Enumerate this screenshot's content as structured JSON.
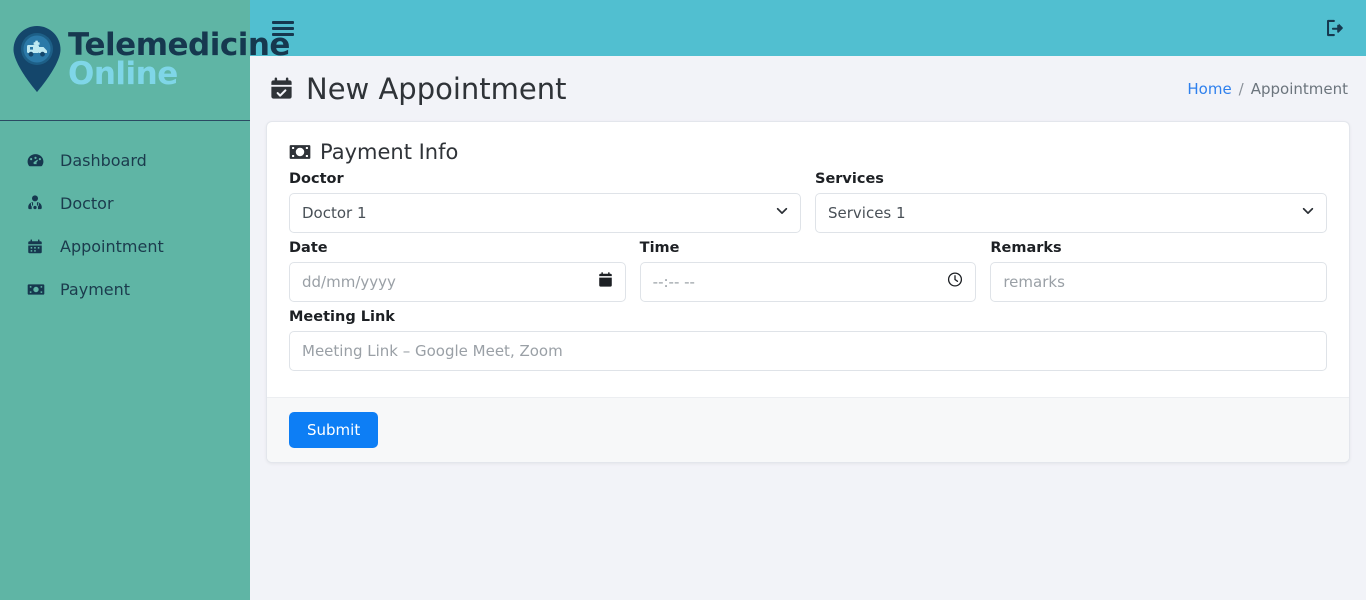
{
  "brand": {
    "line1": "Telemedicine",
    "line2": "Online",
    "logo_icon": "map-pin-ambulance-icon"
  },
  "sidebar": {
    "items": [
      {
        "label": "Dashboard",
        "icon": "tachometer-icon"
      },
      {
        "label": "Doctor",
        "icon": "user-doctor-icon"
      },
      {
        "label": "Appointment",
        "icon": "calendar-days-icon"
      },
      {
        "label": "Payment",
        "icon": "money-bill-icon"
      }
    ]
  },
  "topbar": {
    "menu_icon": "hamburger-icon",
    "logout_icon": "sign-out-icon"
  },
  "page": {
    "title": "New Appointment",
    "title_icon": "calendar-check-icon",
    "breadcrumb": {
      "home": "Home",
      "separator": "/",
      "current": "Appointment"
    }
  },
  "form": {
    "section_title": "Payment Info",
    "section_icon": "money-bill-icon",
    "doctor": {
      "label": "Doctor",
      "value": "Doctor 1",
      "options": [
        "Doctor 1"
      ]
    },
    "services": {
      "label": "Services",
      "value": "Services 1",
      "options": [
        "Services 1"
      ]
    },
    "date": {
      "label": "Date",
      "value": "",
      "placeholder": "dd/mm/yyyy",
      "icon": "calendar-picker-icon"
    },
    "time": {
      "label": "Time",
      "value": "",
      "placeholder": "--:-- --",
      "icon": "clock-icon"
    },
    "remarks": {
      "label": "Remarks",
      "value": "",
      "placeholder": "remarks"
    },
    "meeting_link": {
      "label": "Meeting Link",
      "value": "",
      "placeholder": "Meeting Link – Google Meet, Zoom"
    },
    "submit_label": "Submit"
  },
  "colors": {
    "sidebar": "#5fb5a5",
    "topbar": "#51bfd0",
    "page_bg": "#f2f3f8",
    "brand_dark": "#16384f",
    "brand_light": "#7fd6e8",
    "primary": "#0d7ef5",
    "link": "#2f80ed"
  }
}
